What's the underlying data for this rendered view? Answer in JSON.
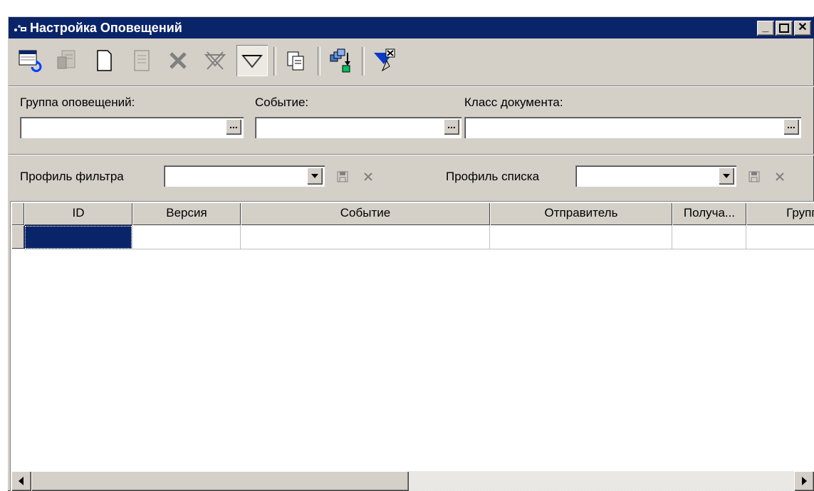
{
  "window": {
    "title": "Настройка Оповещений",
    "title_icon": "bell-settings-icon",
    "minimize_label": "_",
    "maximize_label": "□",
    "close_label": "✕"
  },
  "toolbar": {
    "buttons": [
      {
        "name": "refresh-list-icon",
        "state": "enabled"
      },
      {
        "name": "edit-document-icon",
        "state": "disabled"
      },
      {
        "name": "new-document-icon",
        "state": "enabled"
      },
      {
        "name": "properties-icon",
        "state": "disabled"
      },
      {
        "name": "delete-icon",
        "state": "disabled"
      },
      {
        "name": "clear-filter-icon",
        "state": "disabled"
      },
      {
        "name": "filter-icon",
        "state": "pressed"
      },
      {
        "name": "copy-icon",
        "state": "enabled"
      },
      {
        "name": "export-icon",
        "state": "enabled"
      },
      {
        "name": "reset-filter-icon",
        "state": "enabled"
      }
    ]
  },
  "filters": {
    "group_label": "Группа оповещений:",
    "group_value": "",
    "event_label": "Событие:",
    "event_value": "",
    "doc_class_label": "Класс документа:",
    "doc_class_value": "",
    "ellipsis": "..."
  },
  "profiles": {
    "filter_profile_label": "Профиль фильтра",
    "filter_profile_value": "",
    "list_profile_label": "Профиль списка",
    "list_profile_value": ""
  },
  "grid": {
    "columns": [
      "ID",
      "Версия",
      "Событие",
      "Отправитель",
      "Получа...",
      "Группа"
    ],
    "rows": [
      [
        "",
        "",
        "",
        "",
        "",
        ""
      ]
    ]
  },
  "colors": {
    "titlebar": "#0a246a",
    "face": "#d4d0c8",
    "selection": "#0a246a"
  }
}
